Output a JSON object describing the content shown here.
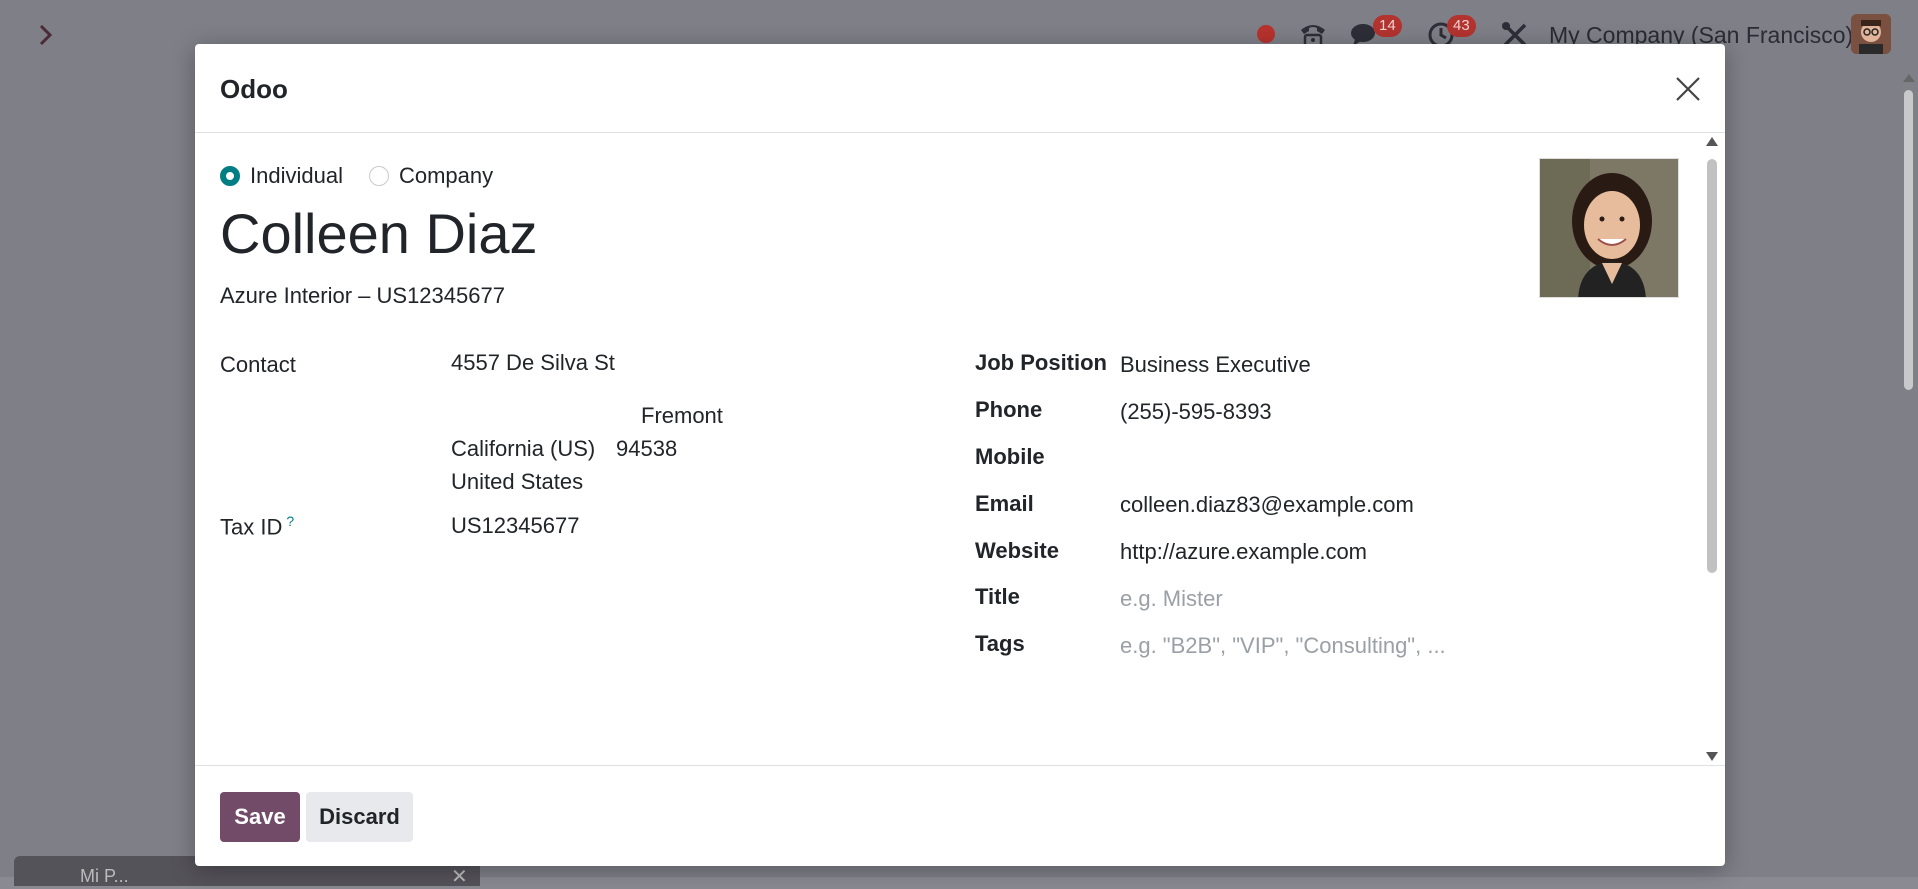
{
  "topbar": {
    "badges": {
      "messages": "14",
      "activities": "43"
    },
    "company": "My Company (San Francisco)"
  },
  "bottom_chat": {
    "title": "Mi P...",
    "close": "✕"
  },
  "dialog": {
    "title": "Odoo",
    "type_options": [
      {
        "label": "Individual",
        "selected": true
      },
      {
        "label": "Company",
        "selected": false
      }
    ],
    "name": "Colleen Diaz",
    "company_line": "Azure Interior – US12345677",
    "left_fields": {
      "contact_label": "Contact",
      "street": "4557 De Silva St",
      "city": "Fremont",
      "state": "California (US)",
      "zip": "94538",
      "country": "United States",
      "tax_label": "Tax ID",
      "tax_help": "?",
      "tax_value": "US12345677"
    },
    "right_fields": {
      "job_label": "Job Position",
      "job_value": "Business Executive",
      "phone_label": "Phone",
      "phone_value": "(255)-595-8393",
      "mobile_label": "Mobile",
      "mobile_value": "",
      "email_label": "Email",
      "email_value": "colleen.diaz83@example.com",
      "website_label": "Website",
      "website_value": "http://azure.example.com",
      "title_label": "Title",
      "title_placeholder": "e.g. Mister",
      "tags_label": "Tags",
      "tags_placeholder": "e.g. \"B2B\", \"VIP\", \"Consulting\", ..."
    },
    "buttons": {
      "save": "Save",
      "discard": "Discard"
    }
  },
  "colors": {
    "primary": "#714b67",
    "teal": "#017e84",
    "badge": "#b3332f"
  }
}
